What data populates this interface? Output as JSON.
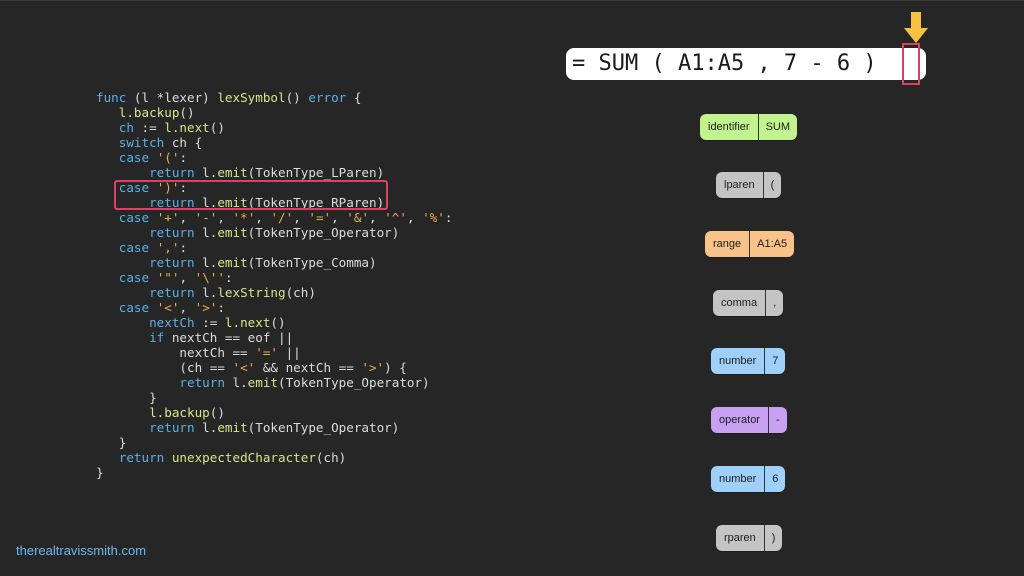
{
  "code_lines": [
    [
      [
        "kw",
        "func"
      ],
      [
        "pl",
        " (l *lexer) "
      ],
      [
        "fn",
        "lexSymbol"
      ],
      [
        "pl",
        "() "
      ],
      [
        "kw",
        "error"
      ],
      [
        "pl",
        " {"
      ]
    ],
    [
      [
        "pl",
        "   "
      ],
      [
        "fn",
        "l.backup"
      ],
      [
        "pl",
        "()"
      ]
    ],
    [
      [
        "pl",
        "   "
      ],
      [
        "kw",
        "ch"
      ],
      [
        "pl",
        " := "
      ],
      [
        "fn",
        "l.next"
      ],
      [
        "pl",
        "()"
      ]
    ],
    [
      [
        "pl",
        "   "
      ],
      [
        "kw",
        "switch"
      ],
      [
        "pl",
        " ch {"
      ]
    ],
    [
      [
        "pl",
        "   "
      ],
      [
        "kw",
        "case"
      ],
      [
        "pl",
        " "
      ],
      [
        "str",
        "'('"
      ],
      [
        "pl",
        ":"
      ]
    ],
    [
      [
        "pl",
        "       "
      ],
      [
        "kw",
        "return"
      ],
      [
        "pl",
        " l."
      ],
      [
        "fn",
        "emit"
      ],
      [
        "pl",
        "(TokenType_LParen)"
      ]
    ],
    [
      [
        "pl",
        "   "
      ],
      [
        "kw",
        "case"
      ],
      [
        "pl",
        " "
      ],
      [
        "str",
        "')'"
      ],
      [
        "pl",
        ":"
      ]
    ],
    [
      [
        "pl",
        "       "
      ],
      [
        "kw",
        "return"
      ],
      [
        "pl",
        " l."
      ],
      [
        "fn",
        "emit"
      ],
      [
        "pl",
        "(TokenType_RParen)"
      ]
    ],
    [
      [
        "pl",
        "   "
      ],
      [
        "kw",
        "case"
      ],
      [
        "pl",
        " "
      ],
      [
        "str",
        "'+'"
      ],
      [
        "pl",
        ", "
      ],
      [
        "str",
        "'-'"
      ],
      [
        "pl",
        ", "
      ],
      [
        "str",
        "'*'"
      ],
      [
        "pl",
        ", "
      ],
      [
        "str",
        "'/'"
      ],
      [
        "pl",
        ", "
      ],
      [
        "str",
        "'='"
      ],
      [
        "pl",
        ", "
      ],
      [
        "str",
        "'&'"
      ],
      [
        "pl",
        ", "
      ],
      [
        "str",
        "'^'"
      ],
      [
        "pl",
        ", "
      ],
      [
        "str",
        "'%'"
      ],
      [
        "pl",
        ":"
      ]
    ],
    [
      [
        "pl",
        "       "
      ],
      [
        "kw",
        "return"
      ],
      [
        "pl",
        " l."
      ],
      [
        "fn",
        "emit"
      ],
      [
        "pl",
        "(TokenType_Operator)"
      ]
    ],
    [
      [
        "pl",
        "   "
      ],
      [
        "kw",
        "case"
      ],
      [
        "pl",
        " "
      ],
      [
        "str",
        "','"
      ],
      [
        "pl",
        ":"
      ]
    ],
    [
      [
        "pl",
        "       "
      ],
      [
        "kw",
        "return"
      ],
      [
        "pl",
        " l."
      ],
      [
        "fn",
        "emit"
      ],
      [
        "pl",
        "(TokenType_Comma)"
      ]
    ],
    [
      [
        "pl",
        "   "
      ],
      [
        "kw",
        "case"
      ],
      [
        "pl",
        " "
      ],
      [
        "str",
        "'\"'"
      ],
      [
        "pl",
        ", "
      ],
      [
        "str",
        "'\\''"
      ],
      [
        "pl",
        ":"
      ]
    ],
    [
      [
        "pl",
        "       "
      ],
      [
        "kw",
        "return"
      ],
      [
        "pl",
        " l."
      ],
      [
        "fn",
        "lexString"
      ],
      [
        "pl",
        "(ch)"
      ]
    ],
    [
      [
        "pl",
        "   "
      ],
      [
        "kw",
        "case"
      ],
      [
        "pl",
        " "
      ],
      [
        "str",
        "'<'"
      ],
      [
        "pl",
        ", "
      ],
      [
        "str",
        "'>'"
      ],
      [
        "pl",
        ":"
      ]
    ],
    [
      [
        "pl",
        "       "
      ],
      [
        "kw",
        "nextCh"
      ],
      [
        "pl",
        " := "
      ],
      [
        "fn",
        "l.next"
      ],
      [
        "pl",
        "()"
      ]
    ],
    [
      [
        "pl",
        "       "
      ],
      [
        "kw",
        "if"
      ],
      [
        "pl",
        " nextCh == eof ||"
      ]
    ],
    [
      [
        "pl",
        "           nextCh == "
      ],
      [
        "str",
        "'='"
      ],
      [
        "pl",
        " ||"
      ]
    ],
    [
      [
        "pl",
        "           (ch == "
      ],
      [
        "str",
        "'<'"
      ],
      [
        "pl",
        " && nextCh == "
      ],
      [
        "str",
        "'>'"
      ],
      [
        "pl",
        ") {"
      ]
    ],
    [
      [
        "pl",
        "           "
      ],
      [
        "kw",
        "return"
      ],
      [
        "pl",
        " l."
      ],
      [
        "fn",
        "emit"
      ],
      [
        "pl",
        "(TokenType_Operator)"
      ]
    ],
    [
      [
        "pl",
        "       }"
      ]
    ],
    [
      [
        "pl",
        "       "
      ],
      [
        "fn",
        "l.backup"
      ],
      [
        "pl",
        "()"
      ]
    ],
    [
      [
        "pl",
        "       "
      ],
      [
        "kw",
        "return"
      ],
      [
        "pl",
        " l."
      ],
      [
        "fn",
        "emit"
      ],
      [
        "pl",
        "(TokenType_Operator)"
      ]
    ],
    [
      [
        "pl",
        "   }"
      ]
    ],
    [
      [
        "pl",
        "   "
      ],
      [
        "kw",
        "return"
      ],
      [
        "pl",
        " "
      ],
      [
        "fn",
        "unexpectedCharacter"
      ],
      [
        "pl",
        "(ch)"
      ]
    ],
    [
      [
        "pl",
        "}"
      ]
    ]
  ],
  "formula": "= SUM ( A1:A5 , 7 - 6 )",
  "tokens": [
    {
      "type": "identifier",
      "value": "SUM",
      "color": "#c3f38f"
    },
    {
      "type": "lparen",
      "value": "(",
      "color": "#c4c4c4"
    },
    {
      "type": "range",
      "value": "A1:A5",
      "color": "#f9c28a"
    },
    {
      "type": "comma",
      "value": ",",
      "color": "#c4c4c4"
    },
    {
      "type": "number",
      "value": "7",
      "color": "#9fd0f9"
    },
    {
      "type": "operator",
      "value": "-",
      "color": "#c9a1f2"
    },
    {
      "type": "number",
      "value": "6",
      "color": "#9fd0f9"
    },
    {
      "type": "rparen",
      "value": ")",
      "color": "#c4c4c4"
    }
  ],
  "footer": "therealtravissmith.com",
  "colors": {
    "background": "#262626",
    "keyword": "#5ab0e8",
    "string": "#e8b04a",
    "function": "#d6e68a",
    "highlight": "#e23d63",
    "arrow": "#f5c242",
    "footer": "#6cb9ee"
  }
}
